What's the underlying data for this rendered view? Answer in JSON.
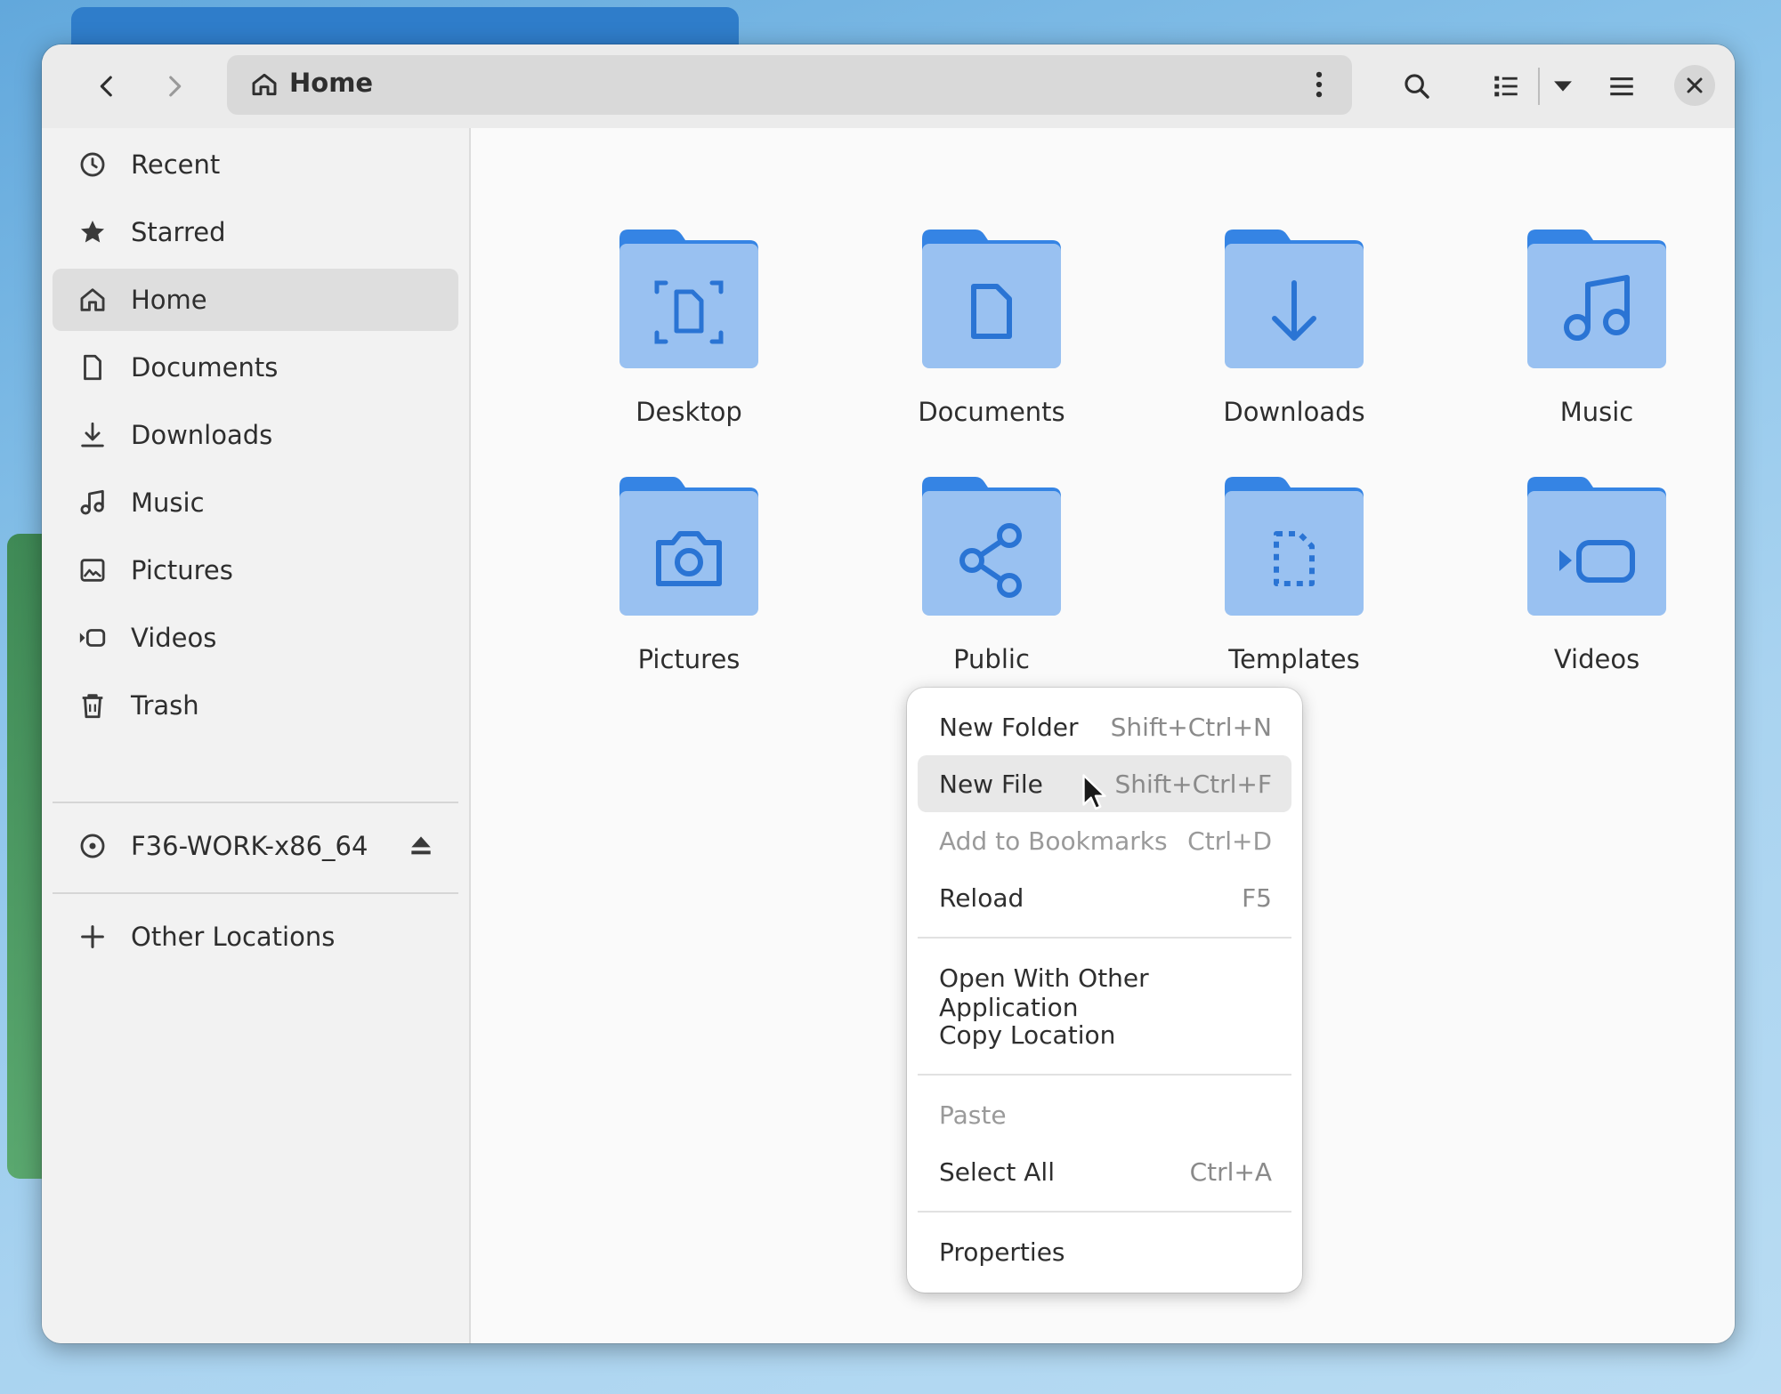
{
  "window": {
    "path_label": "Home"
  },
  "sidebar": {
    "items": [
      {
        "label": "Recent",
        "icon": "clock-icon"
      },
      {
        "label": "Starred",
        "icon": "star-icon"
      },
      {
        "label": "Home",
        "icon": "home-icon",
        "active": true
      },
      {
        "label": "Documents",
        "icon": "document-icon"
      },
      {
        "label": "Downloads",
        "icon": "download-icon"
      },
      {
        "label": "Music",
        "icon": "music-icon"
      },
      {
        "label": "Pictures",
        "icon": "picture-icon"
      },
      {
        "label": "Videos",
        "icon": "video-icon"
      },
      {
        "label": "Trash",
        "icon": "trash-icon"
      }
    ],
    "drive": {
      "label": "F36-WORK-x86_64",
      "icon": "disc-icon",
      "action_icon": "eject-icon"
    },
    "other": {
      "label": "Other Locations",
      "icon": "plus-icon"
    }
  },
  "folders": [
    {
      "label": "Desktop",
      "icon": "desktop-icon"
    },
    {
      "label": "Documents",
      "icon": "document-icon"
    },
    {
      "label": "Downloads",
      "icon": "download-icon"
    },
    {
      "label": "Music",
      "icon": "music-icon"
    },
    {
      "label": "Pictures",
      "icon": "camera-icon"
    },
    {
      "label": "Public",
      "icon": "share-icon"
    },
    {
      "label": "Templates",
      "icon": "template-icon"
    },
    {
      "label": "Videos",
      "icon": "video-icon"
    }
  ],
  "context_menu": {
    "items": [
      {
        "label": "New Folder",
        "shortcut": "Shift+Ctrl+N"
      },
      {
        "label": "New File",
        "shortcut": "Shift+Ctrl+F",
        "hover": true
      },
      {
        "label": "Add to Bookmarks",
        "shortcut": "Ctrl+D",
        "disabled": true
      },
      {
        "label": "Reload",
        "shortcut": "F5"
      },
      {
        "label": "Open With Other Application",
        "shortcut": ""
      },
      {
        "label": "Copy Location",
        "shortcut": ""
      },
      {
        "label": "Paste",
        "shortcut": "",
        "disabled": true
      },
      {
        "label": "Select All",
        "shortcut": "Ctrl+A"
      },
      {
        "label": "Properties",
        "shortcut": ""
      }
    ]
  },
  "colors": {
    "folder_tab": "#3584e4",
    "folder_body": "#99c1f1",
    "folder_glyph": "#2a74d4"
  }
}
